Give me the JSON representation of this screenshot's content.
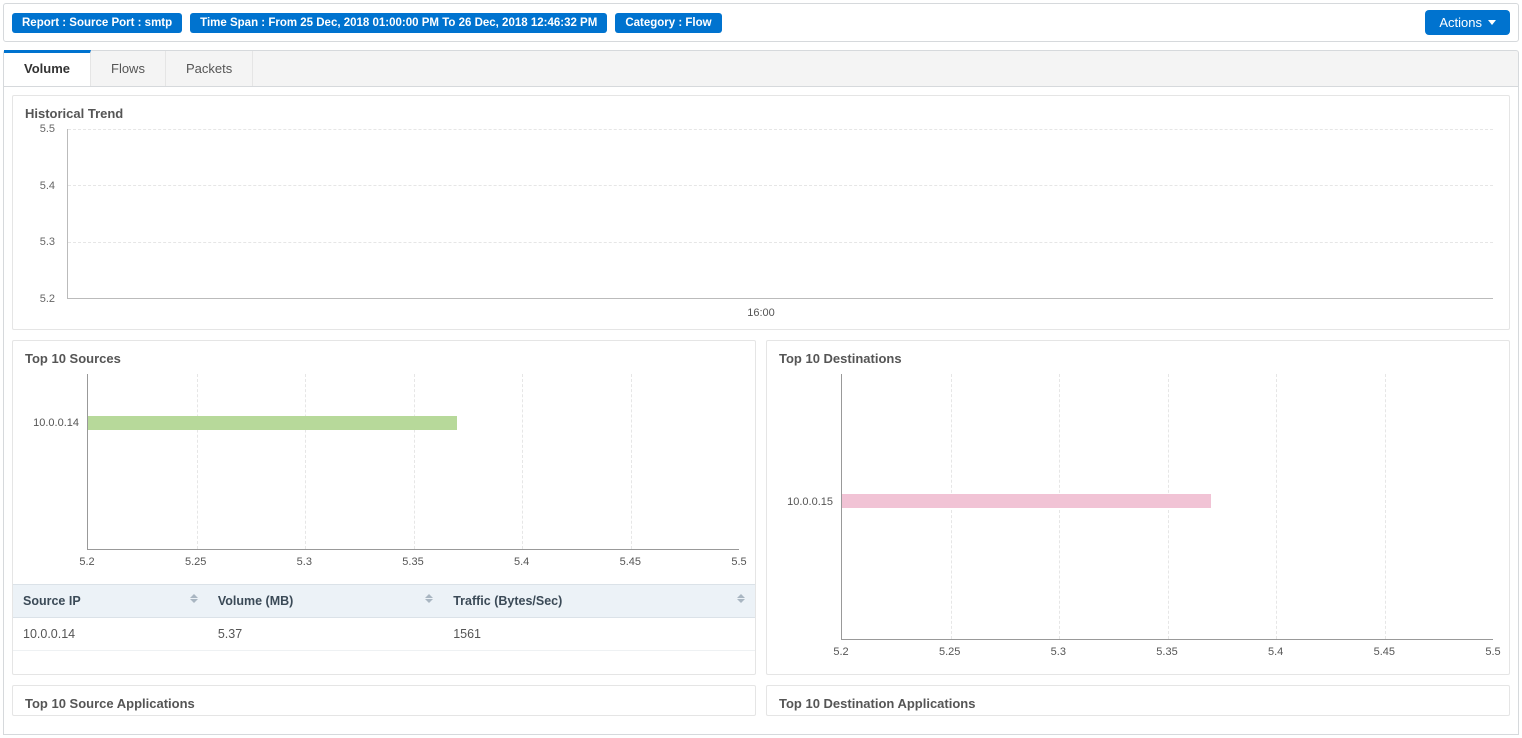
{
  "topbar": {
    "chip_report": "Report : Source Port : smtp",
    "chip_timespan": "Time Span : From 25 Dec, 2018 01:00:00 PM To 26 Dec, 2018 12:46:32 PM",
    "chip_category": "Category : Flow",
    "actions_label": "Actions"
  },
  "tabs": {
    "volume": "Volume",
    "flows": "Flows",
    "packets": "Packets"
  },
  "panels": {
    "historical": "Historical Trend",
    "top_sources": "Top 10 Sources",
    "top_destinations": "Top 10 Destinations",
    "top_src_apps": "Top 10 Source Applications",
    "top_dst_apps": "Top 10 Destination Applications"
  },
  "sources_table": {
    "headers": {
      "ip": "Source IP",
      "volume": "Volume (MB)",
      "traffic": "Traffic (Bytes/Sec)"
    },
    "rows": [
      {
        "ip": "10.0.0.14",
        "volume": "5.37",
        "traffic": "1561"
      }
    ]
  },
  "chart_data": [
    {
      "id": "historical_trend",
      "type": "line",
      "title": "Historical Trend",
      "y_ticks": [
        "5.2",
        "5.3",
        "5.4",
        "5.5"
      ],
      "x_ticks": [
        "16:00"
      ],
      "ylim": [
        5.2,
        5.5
      ],
      "series": []
    },
    {
      "id": "top_sources",
      "type": "bar",
      "orientation": "horizontal",
      "title": "Top 10 Sources",
      "categories": [
        "10.0.0.14"
      ],
      "values": [
        5.37
      ],
      "xlim": [
        5.2,
        5.5
      ],
      "x_ticks": [
        "5.2",
        "5.25",
        "5.3",
        "5.35",
        "5.4",
        "5.45",
        "5.5"
      ],
      "bar_color": "#b7d99a"
    },
    {
      "id": "top_destinations",
      "type": "bar",
      "orientation": "horizontal",
      "title": "Top 10 Destinations",
      "categories": [
        "10.0.0.15"
      ],
      "values": [
        5.37
      ],
      "xlim": [
        5.2,
        5.5
      ],
      "x_ticks": [
        "5.2",
        "5.25",
        "5.3",
        "5.35",
        "5.4",
        "5.45",
        "5.5"
      ],
      "bar_color": "#f1c3d5"
    }
  ]
}
